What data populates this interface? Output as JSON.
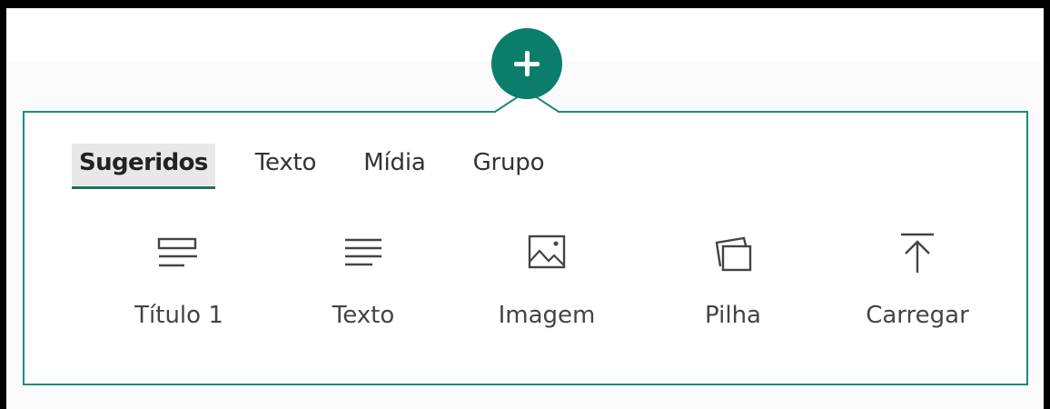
{
  "tabs": [
    {
      "label": "Sugeridos",
      "active": true
    },
    {
      "label": "Texto",
      "active": false
    },
    {
      "label": "Mídia",
      "active": false
    },
    {
      "label": "Grupo",
      "active": false
    }
  ],
  "items": [
    {
      "label": "Título 1",
      "icon": "heading-icon"
    },
    {
      "label": "Texto",
      "icon": "text-lines-icon"
    },
    {
      "label": "Imagem",
      "icon": "image-icon"
    },
    {
      "label": "Pilha",
      "icon": "stack-icon"
    },
    {
      "label": "Carregar",
      "icon": "upload-icon"
    }
  ],
  "add_button": {
    "icon": "plus-icon"
  },
  "colors": {
    "accent": "#0a7d6c",
    "panel_border": "#1f8b78",
    "text": "#444444"
  }
}
